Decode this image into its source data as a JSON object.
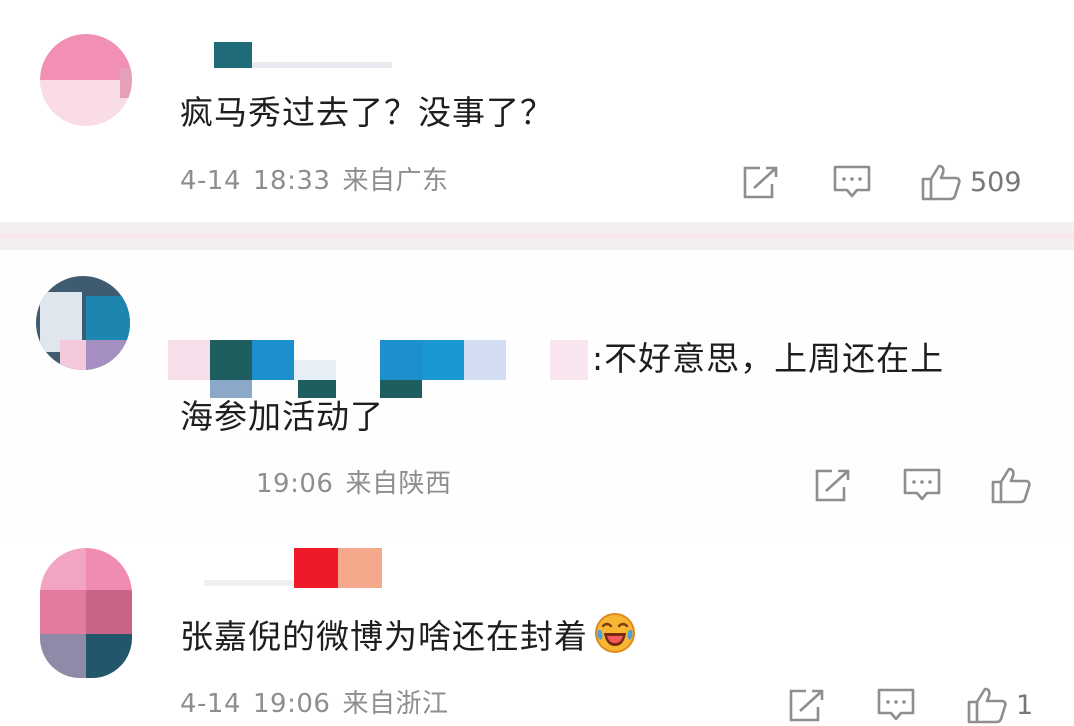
{
  "comments": [
    {
      "text": "疯马秀过去了？没事了？",
      "date": "4-14",
      "time": "18:33",
      "location": "来自广东",
      "likes": "509"
    },
    {
      "text_line1": ":不好意思，上周还在上",
      "text_line2": "海参加活动了",
      "date": "",
      "time": "19:06",
      "location": "来自陕西",
      "likes": ""
    },
    {
      "text": "张嘉倪的微博为啥还在封着",
      "emoji": "laughing-crying-emoji",
      "date": "4-14",
      "time": "19:06",
      "location": "来自浙江",
      "likes": "1"
    }
  ],
  "icons": {
    "share": "share-icon",
    "reply": "comment-icon",
    "like": "thumbs-up-icon"
  },
  "colors": {
    "text": "#1e1e1e",
    "meta": "#8e8e8e",
    "separator": "#f4eef2"
  }
}
